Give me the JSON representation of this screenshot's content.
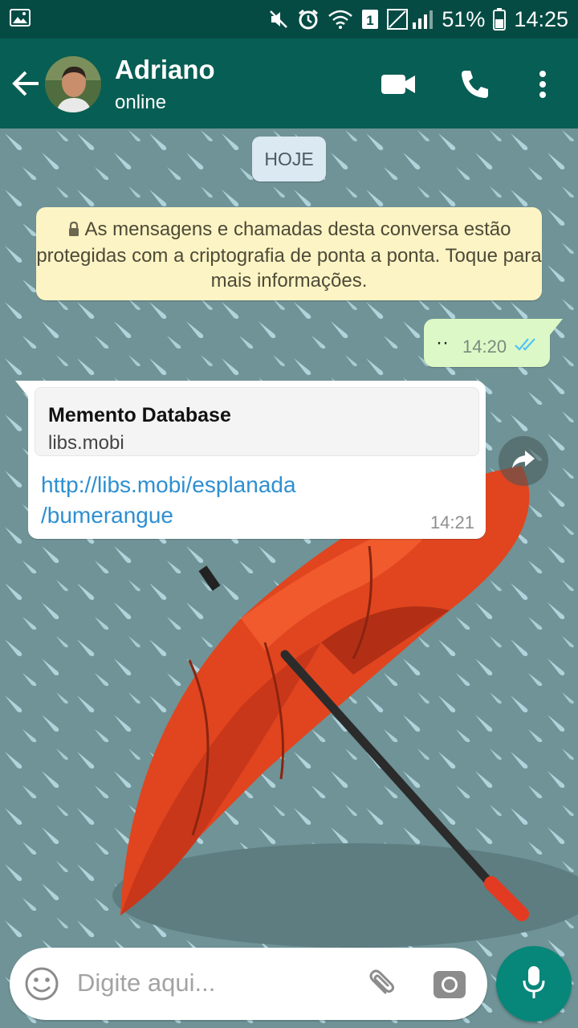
{
  "status_bar": {
    "battery_percent": "51%",
    "time": "14:25",
    "sim_slot": "1",
    "icons": [
      "gallery-icon",
      "mute-icon",
      "alarm-icon",
      "wifi-icon",
      "sim-icon",
      "signal-icon",
      "battery-icon"
    ]
  },
  "header": {
    "contact_name": "Adriano",
    "contact_status": "online",
    "icons": [
      "back-arrow-icon",
      "video-call-icon",
      "phone-icon",
      "more-vert-icon"
    ]
  },
  "chat": {
    "date_chip": "HOJE",
    "encryption_notice": "As mensagens e chamadas desta conversa estão protegidas com a criptografia de ponta a ponta. Toque para mais informações.",
    "outgoing": {
      "text": "··",
      "time": "14:20",
      "status": "read"
    },
    "incoming": {
      "preview_title": "Memento Database",
      "preview_domain": "libs.mobi",
      "link_line1": "http://libs.mobi/esplanada",
      "link_line2": "/bumerangue",
      "time": "14:21"
    }
  },
  "composer": {
    "placeholder": "Digite aqui...",
    "icons": [
      "emoji-icon",
      "attach-icon",
      "camera-icon",
      "mic-icon"
    ]
  },
  "colors": {
    "header": "#075e54",
    "status_bar": "#054b44",
    "outgoing_bubble": "#dcf8c6",
    "encryption_bg": "#fcf4c4",
    "link": "#2e8fd1",
    "mic_button": "#07867a",
    "read_ticks": "#4fc3f7"
  }
}
